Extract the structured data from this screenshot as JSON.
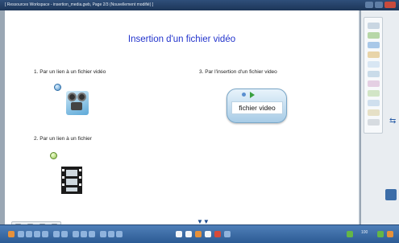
{
  "window": {
    "title": "[ Ressources Workspace - insertion_media.gwb, Page 2/3 (Nouvellement modifié) ]"
  },
  "page": {
    "title": "Insertion d'un fichier vidéo",
    "items": [
      {
        "label": "1. Par un lien à un fichier vidéo"
      },
      {
        "label": "2. Par un lien à un fichier"
      },
      {
        "label": "3. Par l'insertion d'un fichier video"
      }
    ],
    "video_widget_label": "fichier video"
  },
  "icons": {
    "link": "link-badge-icon",
    "projector": "film-projector-icon",
    "filmstrip": "filmstrip-icon",
    "play": "play-icon"
  },
  "toolbar": {
    "zoom_label": "100"
  },
  "colors": {
    "title_blue": "#2233cc",
    "toolbar_blue": "#2c5b94"
  }
}
